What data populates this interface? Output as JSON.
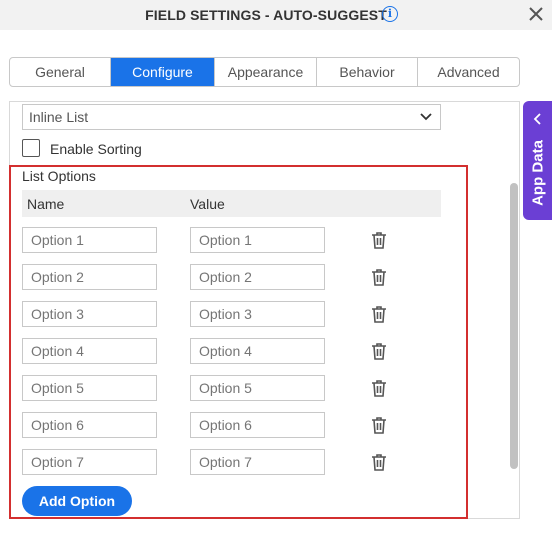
{
  "header": {
    "title": "FIELD SETTINGS - AUTO-SUGGEST",
    "info_icon": "info-icon",
    "close_icon": "close-icon"
  },
  "tabs": [
    {
      "label": "General",
      "active": false
    },
    {
      "label": "Configure",
      "active": true
    },
    {
      "label": "Appearance",
      "active": false
    },
    {
      "label": "Behavior",
      "active": false
    },
    {
      "label": "Advanced",
      "active": false
    }
  ],
  "source_select": {
    "value": "Inline List",
    "icon": "chevron-down-icon"
  },
  "enable_sorting": {
    "label": "Enable Sorting",
    "checked": false
  },
  "list_options": {
    "title": "List Options",
    "columns": {
      "name": "Name",
      "value": "Value"
    },
    "rows": [
      {
        "name_placeholder": "Option 1",
        "value_placeholder": "Option 1"
      },
      {
        "name_placeholder": "Option 2",
        "value_placeholder": "Option 2"
      },
      {
        "name_placeholder": "Option 3",
        "value_placeholder": "Option 3"
      },
      {
        "name_placeholder": "Option 4",
        "value_placeholder": "Option 4"
      },
      {
        "name_placeholder": "Option 5",
        "value_placeholder": "Option 5"
      },
      {
        "name_placeholder": "Option 6",
        "value_placeholder": "Option 6"
      },
      {
        "name_placeholder": "Option 7",
        "value_placeholder": "Option 7"
      }
    ],
    "delete_icon": "trash-icon",
    "add_button_label": "Add Option"
  },
  "app_data_panel": {
    "label": "App Data",
    "icon": "chevron-left-icon"
  },
  "colors": {
    "accent": "#1a73e8",
    "app_data_bg": "#6b3fd4",
    "highlight": "#d32f2f"
  }
}
